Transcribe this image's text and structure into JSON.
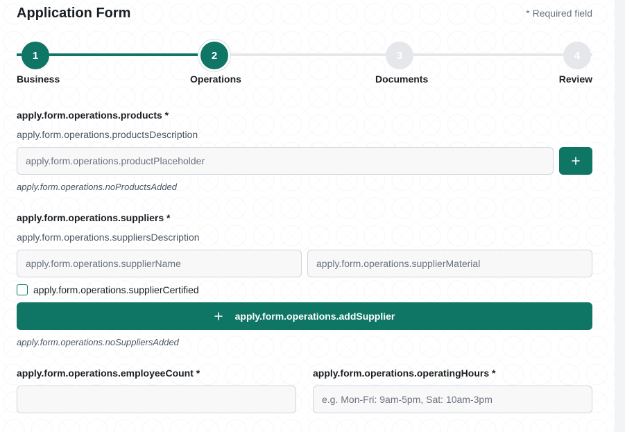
{
  "header": {
    "title": "Application Form",
    "required_note": "* Required field"
  },
  "stepper": {
    "steps": [
      {
        "number": "1",
        "label": "Business",
        "state": "done"
      },
      {
        "number": "2",
        "label": "Operations",
        "state": "active"
      },
      {
        "number": "3",
        "label": "Documents",
        "state": "todo"
      },
      {
        "number": "4",
        "label": "Review",
        "state": "todo"
      }
    ]
  },
  "products": {
    "label": "apply.form.operations.products *",
    "description": "apply.form.operations.productsDescription",
    "input_placeholder": "apply.form.operations.productPlaceholder",
    "input_value": "",
    "add_icon": "plus-icon",
    "empty_hint": "apply.form.operations.noProductsAdded"
  },
  "suppliers": {
    "label": "apply.form.operations.suppliers *",
    "description": "apply.form.operations.suppliersDescription",
    "name_placeholder": "apply.form.operations.supplierName",
    "material_placeholder": "apply.form.operations.supplierMaterial",
    "certified_label": "apply.form.operations.supplierCertified",
    "certified_checked": false,
    "add_button_label": "apply.form.operations.addSupplier",
    "add_icon": "plus-icon",
    "empty_hint": "apply.form.operations.noSuppliersAdded"
  },
  "employees": {
    "label": "apply.form.operations.employeeCount *",
    "input_value": "",
    "input_placeholder": ""
  },
  "hours": {
    "label": "apply.form.operations.operatingHours *",
    "input_value": "",
    "input_placeholder": "e.g. Mon-Fri: 9am-5pm, Sat: 10am-3pm"
  },
  "colors": {
    "accent": "#0f7565",
    "inactive_step": "#e5e7eb",
    "input_bg": "#f8f8f8"
  }
}
